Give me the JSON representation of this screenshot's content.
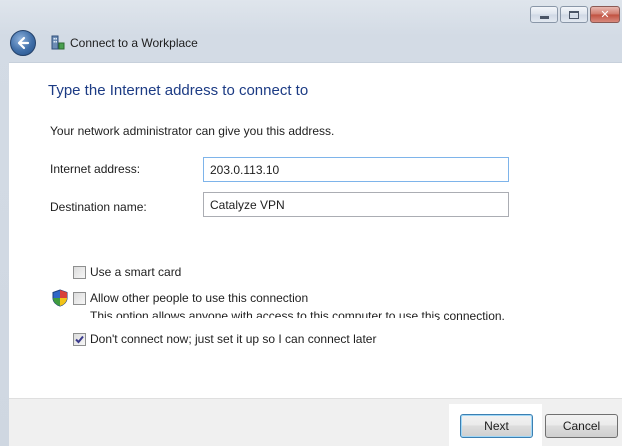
{
  "window": {
    "title": "Connect to a Workplace",
    "caption_buttons": [
      "minimize-icon",
      "maximize-icon",
      "close-icon"
    ]
  },
  "page": {
    "heading": "Type the Internet address to connect to",
    "hint": "Your network administrator can give you this address."
  },
  "form": {
    "internet_address_label": "Internet address:",
    "internet_address_value": "203.0.113.10",
    "destination_name_label": "Destination name:",
    "destination_name_value": "Catalyze VPN"
  },
  "options": {
    "smart_card": {
      "label": "Use a smart card",
      "checked": false
    },
    "allow_others": {
      "label": "Allow other people to use this connection",
      "checked": false,
      "note": "This option allows anyone with access to this computer to use this connection."
    },
    "connect_later": {
      "label": "Don't connect now; just set it up so I can connect later",
      "checked": true
    }
  },
  "buttons": {
    "next": "Next",
    "cancel": "Cancel"
  },
  "colors": {
    "heading": "#1c3b84",
    "highlight": "#ffffff",
    "frame": "#d3dbe5"
  }
}
